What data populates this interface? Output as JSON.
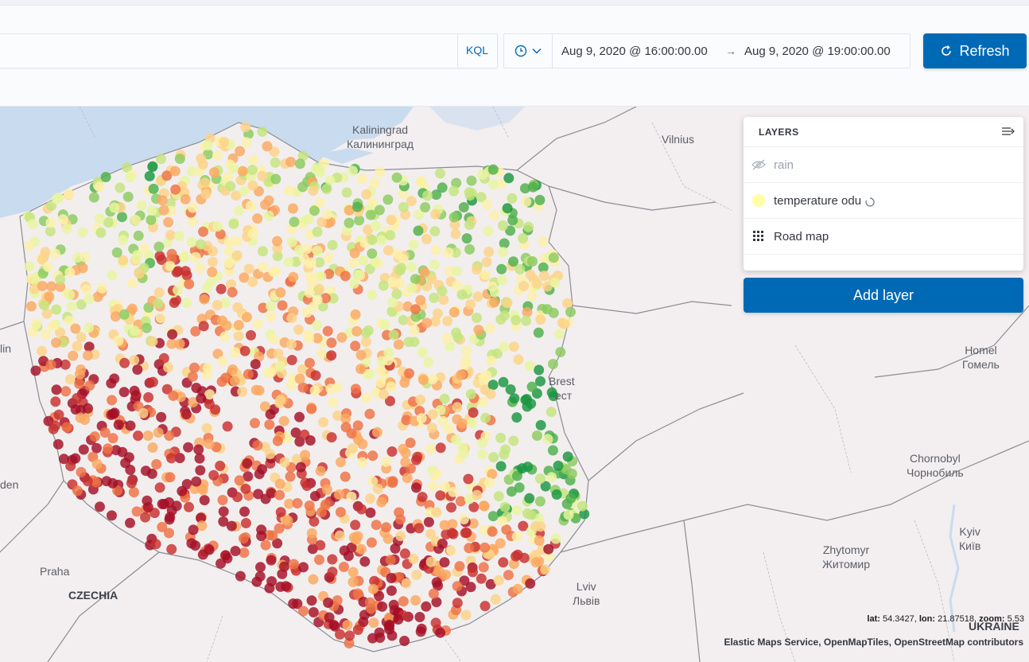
{
  "query_bar": {
    "kql_label": "KQL",
    "time_start": "Aug 9, 2020 @ 16:00:00.00",
    "time_arrow": "→",
    "time_end": "Aug 9, 2020 @ 19:00:00.00",
    "refresh_label": "Refresh"
  },
  "layers_panel": {
    "title": "LAYERS",
    "layers": [
      {
        "label": "rain",
        "icon": "eye-closed-icon",
        "hidden": true
      },
      {
        "label": "temperature odu",
        "icon": "yellow-circle-icon",
        "hidden": false
      },
      {
        "label": "Road map",
        "icon": "grid-icon",
        "hidden": false
      }
    ],
    "add_layer_label": "Add layer"
  },
  "map": {
    "labels": {
      "kaliningrad": "Kaliningrad",
      "kaliningrad_local": "Калининград",
      "vilnius": "Vilnius",
      "homel": "Homel",
      "homel_local": "Гомель",
      "brest": "Brest",
      "brest_local": "ест",
      "chornobyl": "Chornobyl",
      "chornobyl_local": "Чорнобиль",
      "kyiv": "Kyiv",
      "kyiv_local": "Київ",
      "zhytomyr": "Zhytomyr",
      "zhytomyr_local": "Житомир",
      "lviv": "Lviv",
      "lviv_local": "Львів",
      "praha": "Praha",
      "czechia": "CZECHIA",
      "ukraine": "UKRAINE",
      "berlin_partial": "lin",
      "dresden_partial": "den"
    },
    "coordinates": {
      "lat_label": "lat:",
      "lat": "54.3427",
      "lon_label": "lon:",
      "lon": "21.87518",
      "zoom_label": "zoom:",
      "zoom": "5.53"
    },
    "attribution": "Elastic Maps Service, OpenMapTiles, OpenStreetMap contributors",
    "colors": {
      "water": "#c9dbef",
      "land": "#f3eef0",
      "point_cold": "#1a9641",
      "point_hot": "#b2182b"
    }
  }
}
